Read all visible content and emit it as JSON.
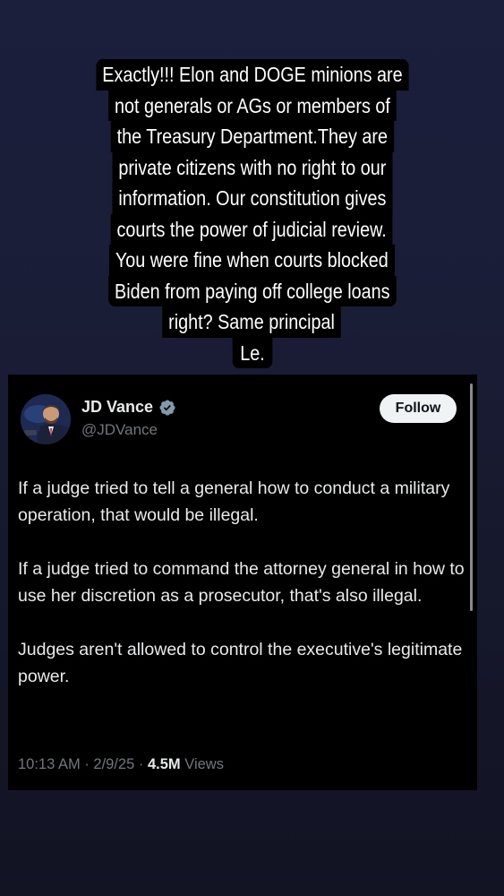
{
  "caption": {
    "lines": [
      "Exactly!!! Elon and DOGE minions are",
      "not generals or AGs or members of",
      "the Treasury Department.They are",
      "private citizens with no right to our",
      "information. Our constitution gives",
      "courts the power of judicial review.",
      "You were fine when courts blocked",
      "Biden from paying off college loans",
      "right? Same principal",
      "Le."
    ]
  },
  "tweet": {
    "author_name": "JD Vance",
    "handle": "@JDVance",
    "follow_label": "Follow",
    "paragraphs": [
      "If a judge tried to tell a general how to conduct a military operation, that would be illegal.",
      "If a judge tried to command the attorney general in how to use her discretion as a prosecutor, that's also illegal.",
      "Judges aren't allowed to control the executive's legitimate power."
    ],
    "time": "10:13 AM",
    "date": "2/9/25",
    "views_count": "4.5M",
    "views_label": "Views",
    "separator": "·",
    "verified_icon": "verified-badge-icon"
  },
  "colors": {
    "background_top": "#1b1f3c",
    "tweet_bg": "#000000",
    "text_primary": "#e7e9ea",
    "text_secondary": "#71767b",
    "follow_bg": "#eff3f4",
    "verified_badge": "#829aab"
  }
}
